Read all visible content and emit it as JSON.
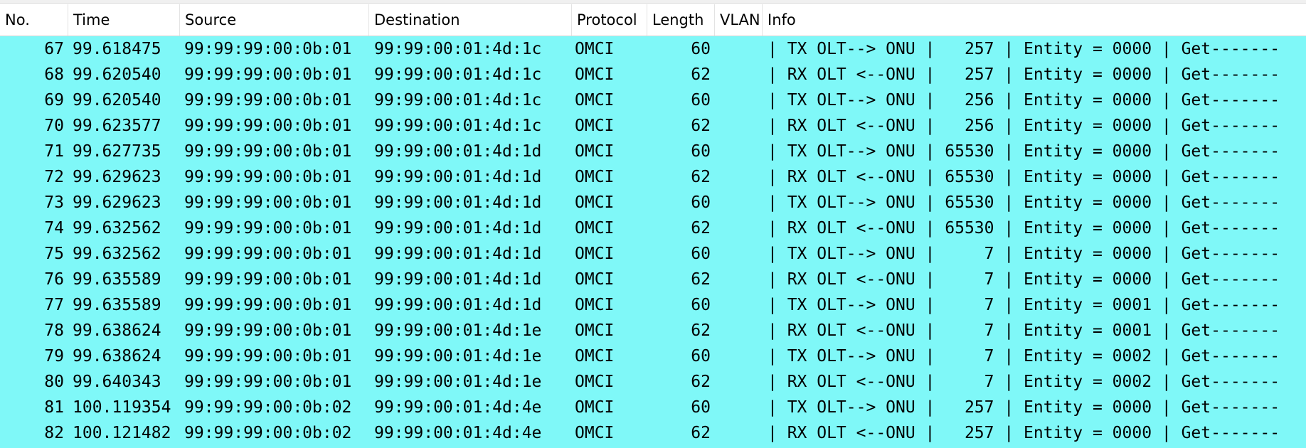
{
  "columns": {
    "no": "No.",
    "time": "Time",
    "source": "Source",
    "destination": "Destination",
    "protocol": "Protocol",
    "length": "Length",
    "vlan": "VLAN",
    "info": "Info"
  },
  "colors": {
    "row_background": "#7ff8f8",
    "header_background": "#ffffff"
  },
  "packets": [
    {
      "no": "67",
      "time": "99.618475",
      "source": "99:99:99:00:0b:01",
      "destination": "99:99:00:01:4d:1c",
      "protocol": "OMCI",
      "length": "60",
      "vlan": "",
      "info": "| TX OLT--> ONU |   257 | Entity = 0000 | Get-------"
    },
    {
      "no": "68",
      "time": "99.620540",
      "source": "99:99:99:00:0b:01",
      "destination": "99:99:00:01:4d:1c",
      "protocol": "OMCI",
      "length": "62",
      "vlan": "",
      "info": "| RX OLT <--ONU |   257 | Entity = 0000 | Get-------"
    },
    {
      "no": "69",
      "time": "99.620540",
      "source": "99:99:99:00:0b:01",
      "destination": "99:99:00:01:4d:1c",
      "protocol": "OMCI",
      "length": "60",
      "vlan": "",
      "info": "| TX OLT--> ONU |   256 | Entity = 0000 | Get-------"
    },
    {
      "no": "70",
      "time": "99.623577",
      "source": "99:99:99:00:0b:01",
      "destination": "99:99:00:01:4d:1c",
      "protocol": "OMCI",
      "length": "62",
      "vlan": "",
      "info": "| RX OLT <--ONU |   256 | Entity = 0000 | Get-------"
    },
    {
      "no": "71",
      "time": "99.627735",
      "source": "99:99:99:00:0b:01",
      "destination": "99:99:00:01:4d:1d",
      "protocol": "OMCI",
      "length": "60",
      "vlan": "",
      "info": "| TX OLT--> ONU | 65530 | Entity = 0000 | Get-------"
    },
    {
      "no": "72",
      "time": "99.629623",
      "source": "99:99:99:00:0b:01",
      "destination": "99:99:00:01:4d:1d",
      "protocol": "OMCI",
      "length": "62",
      "vlan": "",
      "info": "| RX OLT <--ONU | 65530 | Entity = 0000 | Get-------"
    },
    {
      "no": "73",
      "time": "99.629623",
      "source": "99:99:99:00:0b:01",
      "destination": "99:99:00:01:4d:1d",
      "protocol": "OMCI",
      "length": "60",
      "vlan": "",
      "info": "| TX OLT--> ONU | 65530 | Entity = 0000 | Get-------"
    },
    {
      "no": "74",
      "time": "99.632562",
      "source": "99:99:99:00:0b:01",
      "destination": "99:99:00:01:4d:1d",
      "protocol": "OMCI",
      "length": "62",
      "vlan": "",
      "info": "| RX OLT <--ONU | 65530 | Entity = 0000 | Get-------"
    },
    {
      "no": "75",
      "time": "99.632562",
      "source": "99:99:99:00:0b:01",
      "destination": "99:99:00:01:4d:1d",
      "protocol": "OMCI",
      "length": "60",
      "vlan": "",
      "info": "| TX OLT--> ONU |     7 | Entity = 0000 | Get-------"
    },
    {
      "no": "76",
      "time": "99.635589",
      "source": "99:99:99:00:0b:01",
      "destination": "99:99:00:01:4d:1d",
      "protocol": "OMCI",
      "length": "62",
      "vlan": "",
      "info": "| RX OLT <--ONU |     7 | Entity = 0000 | Get-------"
    },
    {
      "no": "77",
      "time": "99.635589",
      "source": "99:99:99:00:0b:01",
      "destination": "99:99:00:01:4d:1d",
      "protocol": "OMCI",
      "length": "60",
      "vlan": "",
      "info": "| TX OLT--> ONU |     7 | Entity = 0001 | Get-------"
    },
    {
      "no": "78",
      "time": "99.638624",
      "source": "99:99:99:00:0b:01",
      "destination": "99:99:00:01:4d:1e",
      "protocol": "OMCI",
      "length": "62",
      "vlan": "",
      "info": "| RX OLT <--ONU |     7 | Entity = 0001 | Get-------"
    },
    {
      "no": "79",
      "time": "99.638624",
      "source": "99:99:99:00:0b:01",
      "destination": "99:99:00:01:4d:1e",
      "protocol": "OMCI",
      "length": "60",
      "vlan": "",
      "info": "| TX OLT--> ONU |     7 | Entity = 0002 | Get-------"
    },
    {
      "no": "80",
      "time": "99.640343",
      "source": "99:99:99:00:0b:01",
      "destination": "99:99:00:01:4d:1e",
      "protocol": "OMCI",
      "length": "62",
      "vlan": "",
      "info": "| RX OLT <--ONU |     7 | Entity = 0002 | Get-------"
    },
    {
      "no": "81",
      "time": "100.119354",
      "source": "99:99:99:00:0b:02",
      "destination": "99:99:00:01:4d:4e",
      "protocol": "OMCI",
      "length": "60",
      "vlan": "",
      "info": "| TX OLT--> ONU |   257 | Entity = 0000 | Get-------"
    },
    {
      "no": "82",
      "time": "100.121482",
      "source": "99:99:99:00:0b:02",
      "destination": "99:99:00:01:4d:4e",
      "protocol": "OMCI",
      "length": "62",
      "vlan": "",
      "info": "| RX OLT <--ONU |   257 | Entity = 0000 | Get-------"
    }
  ]
}
